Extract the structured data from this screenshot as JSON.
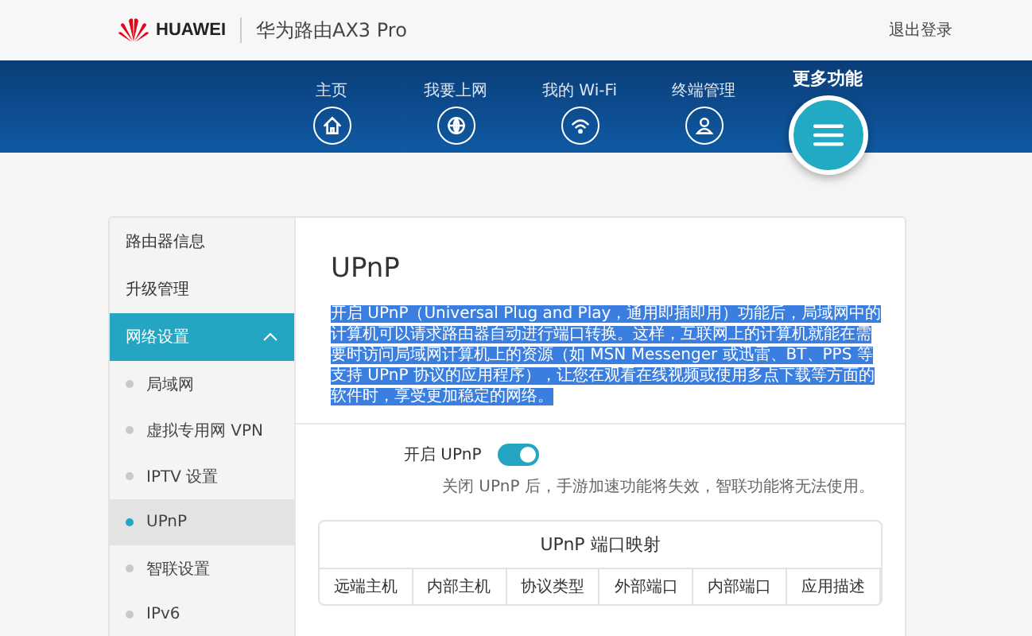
{
  "header": {
    "brand": "HUAWEI",
    "product": "华为路由AX3 Pro",
    "logout": "退出登录"
  },
  "nav": [
    {
      "label": "主页",
      "kind": "home",
      "selected": false
    },
    {
      "label": "我要上网",
      "kind": "globe",
      "selected": false
    },
    {
      "label": "我的 Wi-Fi",
      "kind": "wifi",
      "selected": false
    },
    {
      "label": "终端管理",
      "kind": "user",
      "selected": false
    },
    {
      "label": "更多功能",
      "kind": "menu",
      "selected": true
    }
  ],
  "sidebar": {
    "items": [
      {
        "label": "路由器信息",
        "selected": false
      },
      {
        "label": "升级管理",
        "selected": false
      },
      {
        "label": "网络设置",
        "selected": true,
        "expanded": true,
        "children": [
          {
            "label": "局域网",
            "selected": false
          },
          {
            "label": "虚拟专用网 VPN",
            "selected": false
          },
          {
            "label": "IPTV 设置",
            "selected": false
          },
          {
            "label": "UPnP",
            "selected": true
          },
          {
            "label": "智联设置",
            "selected": false
          },
          {
            "label": "IPv6",
            "selected": false
          }
        ]
      }
    ]
  },
  "content": {
    "title": "UPnP",
    "description": "开启 UPnP（Universal Plug and Play，通用即插即用）功能后，局域网中的计算机可以请求路由器自动进行端口转换。这样，互联网上的计算机就能在需要时访问局域网计算机上的资源（如 MSN Messenger 或迅雷、BT、PPS 等支持 UPnP 协议的应用程序），让您在观看在线视频或使用多点下载等方面的软件时，享受更加稳定的网络。",
    "description_selected": true,
    "toggle": {
      "label": "开启 UPnP",
      "on": true
    },
    "hint": "关闭 UPnP 后，手游加速功能将失效，智联功能将无法使用。",
    "table": {
      "title": "UPnP 端口映射",
      "columns": [
        "远端主机",
        "内部主机",
        "协议类型",
        "外部端口",
        "内部端口",
        "应用描述"
      ]
    }
  }
}
